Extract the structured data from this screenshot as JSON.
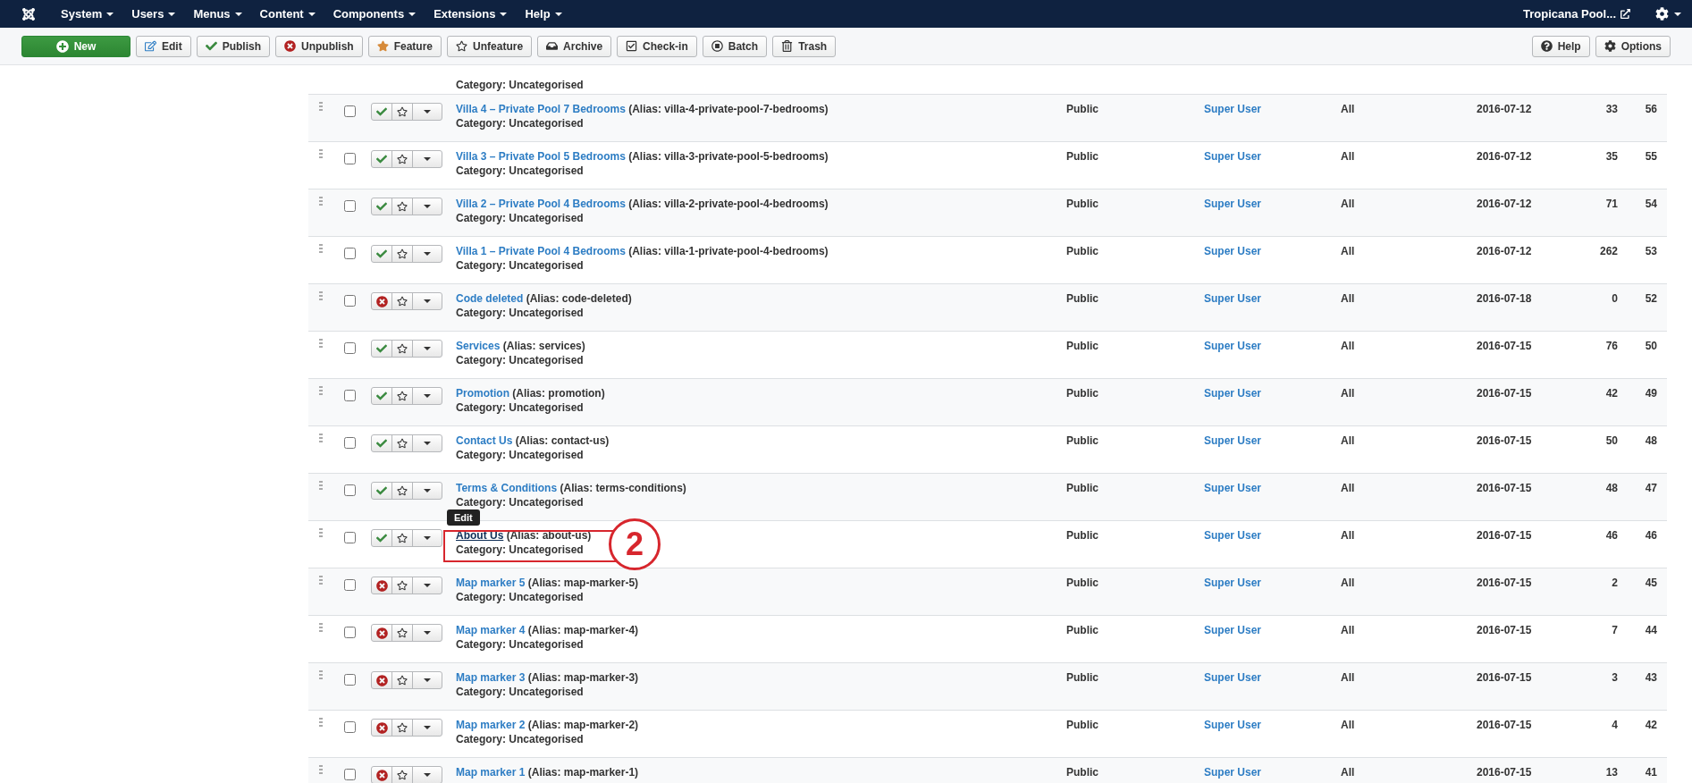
{
  "nav": {
    "menus": [
      {
        "label": "System"
      },
      {
        "label": "Users"
      },
      {
        "label": "Menus"
      },
      {
        "label": "Content"
      },
      {
        "label": "Components"
      },
      {
        "label": "Extensions"
      },
      {
        "label": "Help"
      }
    ],
    "site": "Tropicana Pool..."
  },
  "toolbar": {
    "buttons": [
      {
        "kind": "new",
        "label": "New"
      },
      {
        "kind": "edit",
        "label": "Edit"
      },
      {
        "kind": "publish",
        "label": "Publish"
      },
      {
        "kind": "unpublish",
        "label": "Unpublish"
      },
      {
        "kind": "feature",
        "label": "Feature"
      },
      {
        "kind": "unfeature",
        "label": "Unfeature"
      },
      {
        "kind": "archive",
        "label": "Archive"
      },
      {
        "kind": "checkin",
        "label": "Check-in"
      },
      {
        "kind": "batch",
        "label": "Batch"
      },
      {
        "kind": "trash",
        "label": "Trash"
      }
    ],
    "right_buttons": [
      {
        "kind": "help",
        "label": "Help"
      },
      {
        "kind": "options",
        "label": "Options"
      }
    ]
  },
  "partial_row": {
    "category": "Category: Uncategorised"
  },
  "articles": [
    {
      "checked": false,
      "title": "Villa 4 – Private Pool 7 Bedrooms",
      "alias": "(Alias: villa-4-private-pool-7-bedrooms)",
      "category": "Category: Uncategorised",
      "published": true,
      "access": "Public",
      "author": "Super User",
      "language": "All",
      "date": "2016-07-12",
      "hits": "33",
      "id": "56"
    },
    {
      "checked": false,
      "title": "Villa 3 – Private Pool 5 Bedrooms",
      "alias": "(Alias: villa-3-private-pool-5-bedrooms)",
      "category": "Category: Uncategorised",
      "published": true,
      "access": "Public",
      "author": "Super User",
      "language": "All",
      "date": "2016-07-12",
      "hits": "35",
      "id": "55"
    },
    {
      "checked": false,
      "title": "Villa 2 – Private Pool 4 Bedrooms",
      "alias": "(Alias: villa-2-private-pool-4-bedrooms)",
      "category": "Category: Uncategorised",
      "published": true,
      "access": "Public",
      "author": "Super User",
      "language": "All",
      "date": "2016-07-12",
      "hits": "71",
      "id": "54"
    },
    {
      "checked": false,
      "title": "Villa 1 – Private Pool 4 Bedrooms",
      "alias": "(Alias: villa-1-private-pool-4-bedrooms)",
      "category": "Category: Uncategorised",
      "published": true,
      "access": "Public",
      "author": "Super User",
      "language": "All",
      "date": "2016-07-12",
      "hits": "262",
      "id": "53"
    },
    {
      "checked": false,
      "title": "Code deleted",
      "alias": "(Alias: code-deleted)",
      "category": "Category: Uncategorised",
      "published": false,
      "access": "Public",
      "author": "Super User",
      "language": "All",
      "date": "2016-07-18",
      "hits": "0",
      "id": "52"
    },
    {
      "checked": false,
      "title": "Services",
      "alias": "(Alias: services)",
      "category": "Category: Uncategorised",
      "published": true,
      "access": "Public",
      "author": "Super User",
      "language": "All",
      "date": "2016-07-15",
      "hits": "76",
      "id": "50"
    },
    {
      "checked": false,
      "title": "Promotion",
      "alias": "(Alias: promotion)",
      "category": "Category: Uncategorised",
      "published": true,
      "access": "Public",
      "author": "Super User",
      "language": "All",
      "date": "2016-07-15",
      "hits": "42",
      "id": "49"
    },
    {
      "checked": false,
      "title": "Contact Us",
      "alias": "(Alias: contact-us)",
      "category": "Category: Uncategorised",
      "published": true,
      "access": "Public",
      "author": "Super User",
      "language": "All",
      "date": "2016-07-15",
      "hits": "50",
      "id": "48"
    },
    {
      "checked": false,
      "title": "Terms & Conditions",
      "alias": "(Alias: terms-conditions)",
      "category": "Category: Uncategorised",
      "published": true,
      "access": "Public",
      "author": "Super User",
      "language": "All",
      "date": "2016-07-15",
      "hits": "48",
      "id": "47"
    },
    {
      "checked": false,
      "title": "About Us",
      "alias": "(Alias: about-us)",
      "category": "Category: Uncategorised",
      "published": true,
      "hovered": true,
      "tooltip": "Edit",
      "callout": "2",
      "access": "Public",
      "author": "Super User",
      "language": "All",
      "date": "2016-07-15",
      "hits": "46",
      "id": "46"
    },
    {
      "checked": false,
      "title": "Map marker 5",
      "alias": "(Alias: map-marker-5)",
      "category": "Category: Uncategorised",
      "published": false,
      "access": "Public",
      "author": "Super User",
      "language": "All",
      "date": "2016-07-15",
      "hits": "2",
      "id": "45"
    },
    {
      "checked": false,
      "title": "Map marker 4",
      "alias": "(Alias: map-marker-4)",
      "category": "Category: Uncategorised",
      "published": false,
      "access": "Public",
      "author": "Super User",
      "language": "All",
      "date": "2016-07-15",
      "hits": "7",
      "id": "44"
    },
    {
      "checked": false,
      "title": "Map marker 3",
      "alias": "(Alias: map-marker-3)",
      "category": "Category: Uncategorised",
      "published": false,
      "access": "Public",
      "author": "Super User",
      "language": "All",
      "date": "2016-07-15",
      "hits": "3",
      "id": "43"
    },
    {
      "checked": false,
      "title": "Map marker 2",
      "alias": "(Alias: map-marker-2)",
      "category": "Category: Uncategorised",
      "published": false,
      "access": "Public",
      "author": "Super User",
      "language": "All",
      "date": "2016-07-15",
      "hits": "4",
      "id": "42"
    },
    {
      "checked": false,
      "title": "Map marker 1",
      "alias": "(Alias: map-marker-1)",
      "published": false,
      "access": "Public",
      "author": "Super User",
      "language": "All",
      "date": "2016-07-15",
      "hits": "13",
      "id": "41"
    }
  ]
}
